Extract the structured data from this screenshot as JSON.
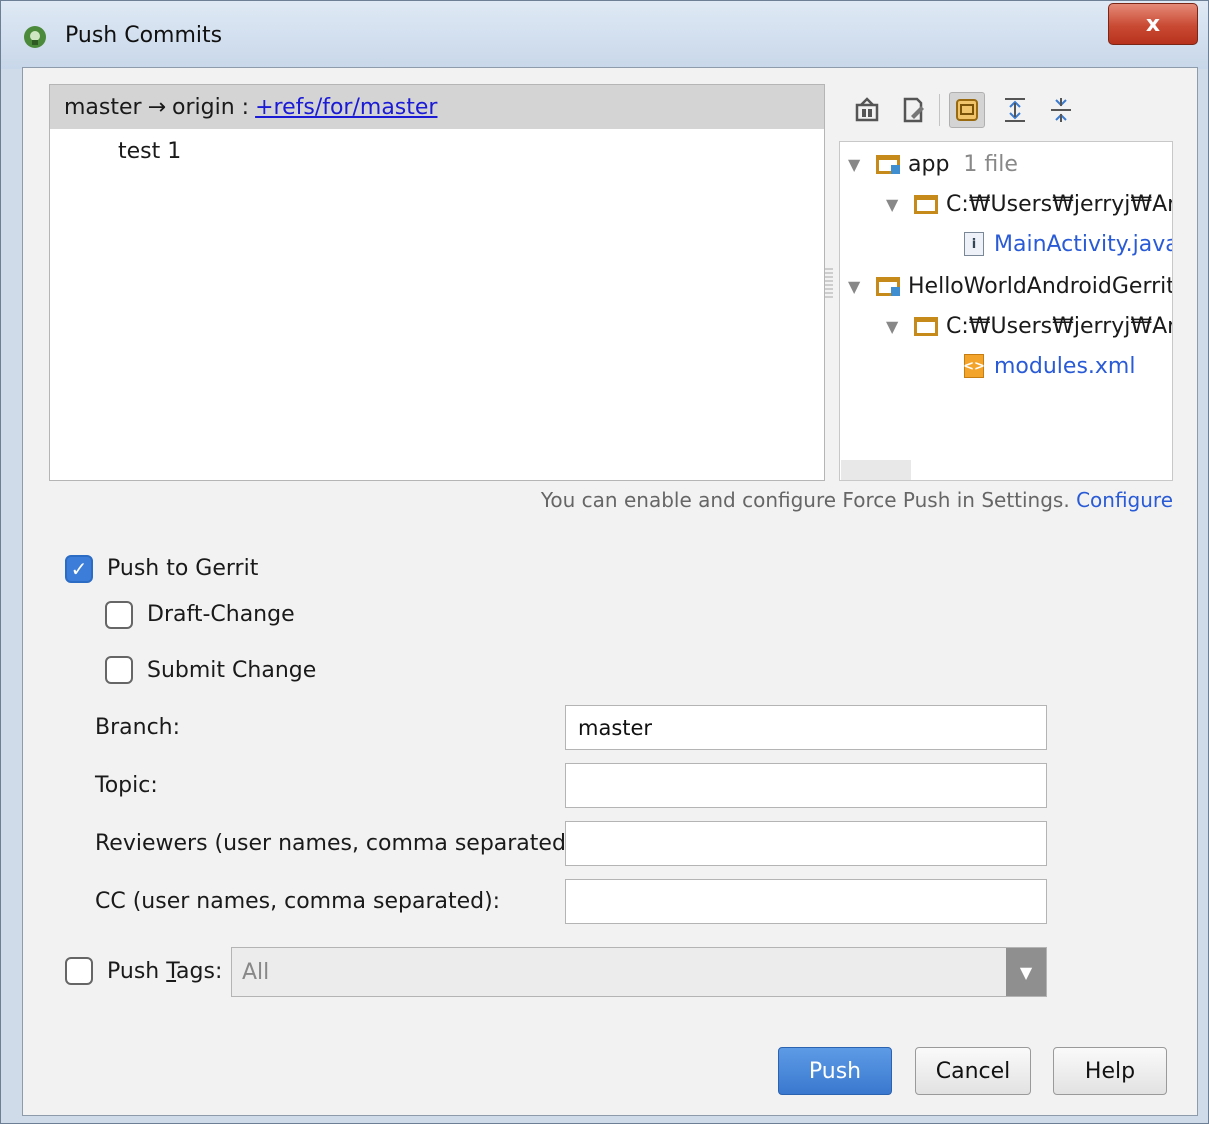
{
  "window": {
    "title": "Push Commits",
    "close_glyph": "x"
  },
  "commits": {
    "branch_from": "master",
    "arrow": "→",
    "remote": "origin :",
    "target_ref": "+refs/for/master",
    "items": [
      "test 1"
    ]
  },
  "toolbar": {
    "icons": [
      "show-diff-icon",
      "edit-source-icon",
      "group-by-directory-icon",
      "expand-all-icon",
      "collapse-all-icon"
    ]
  },
  "file_tree": {
    "app": {
      "label": "app",
      "count": "1 file"
    },
    "app_path": "C:₩Users₩jerryj₩And",
    "app_file": "MainActivity.java",
    "project": {
      "label": "HelloWorldAndroidGerrit"
    },
    "project_path": "C:₩Users₩jerryj₩And",
    "project_file": "modules.xml"
  },
  "force_push": {
    "note": "You can enable and configure Force Push in Settings.",
    "link": "Configure"
  },
  "gerrit": {
    "push_to_gerrit": {
      "label": "Push to Gerrit",
      "checked": true
    },
    "draft_change": {
      "label": "Draft-Change",
      "checked": false
    },
    "submit_change": {
      "label": "Submit Change",
      "checked": false
    },
    "branch": {
      "label": "Branch:",
      "value": "master"
    },
    "topic": {
      "label": "Topic:",
      "value": ""
    },
    "reviewers": {
      "label": "Reviewers (user names, comma separated):",
      "value": ""
    },
    "cc": {
      "label": "CC (user names, comma separated):",
      "value": ""
    }
  },
  "push_tags": {
    "label_prefix": "Push ",
    "label_mnemonic": "T",
    "label_suffix": "ags:",
    "checked": false,
    "selected": "All"
  },
  "buttons": {
    "push": "Push",
    "cancel": "Cancel",
    "help": "Help"
  },
  "colors": {
    "accent": "#3a78cf",
    "link": "#1b1bd6",
    "close": "#c94a33"
  }
}
